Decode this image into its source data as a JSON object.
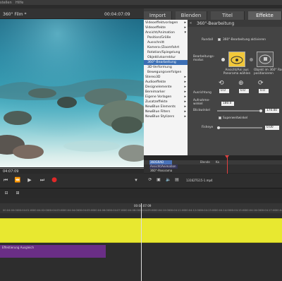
{
  "menubar": {
    "items": [
      "stellen",
      "Hilfe"
    ]
  },
  "preview": {
    "title": "360° Film *",
    "timecode": "00:04:07:09",
    "position_time": "04:07:09"
  },
  "tabs": [
    {
      "label": "Import"
    },
    {
      "label": "Blenden"
    },
    {
      "label": "Titel"
    },
    {
      "label": "Effekte",
      "active": true
    }
  ],
  "effect_list": [
    {
      "label": "Videoeffektvorlagen",
      "arrow": "▸"
    },
    {
      "label": "Videoeffekte",
      "arrow": "▸"
    },
    {
      "label": "Ansicht/Animation",
      "arrow": "▾"
    },
    {
      "label": "Position/Größe",
      "sub": true
    },
    {
      "label": "Ausschnitt",
      "sub": true
    },
    {
      "label": "Kamera-/Zoomfahrt",
      "sub": true
    },
    {
      "label": "Rotation/Spiegelung",
      "sub": true
    },
    {
      "label": "Objektivkorrektur",
      "sub": true
    },
    {
      "label": "360°-Bearbeitung",
      "sub": true,
      "selected": true
    },
    {
      "label": "3D-Verformung",
      "sub": true
    },
    {
      "label": "Bewegungsverfolgen",
      "sub": true
    },
    {
      "label": "Stereo3D",
      "arrow": "▸"
    },
    {
      "label": "Audioeffekte",
      "arrow": "▸"
    },
    {
      "label": "Designelemente",
      "arrow": "▸"
    },
    {
      "label": "Bereimarker",
      "arrow": "▸"
    },
    {
      "label": "Eigene Vorlagen",
      "arrow": "▸"
    },
    {
      "label": "Zusatzeffekte",
      "arrow": "▸"
    },
    {
      "label": "NewBlue Elements",
      "arrow": "▸"
    },
    {
      "label": "NewBlue Filters",
      "arrow": "▸"
    },
    {
      "label": "NewBlue Stylizers",
      "arrow": "▸"
    }
  ],
  "props": {
    "header": "360°-Bearbeitung",
    "rundall": "Rundall",
    "enable_label": "360°-Bearbeitung aktivieren",
    "mode_label": "Bearbeitungs-\nmodus",
    "opt1": "Ansicht/Ani aus\nPanorama wählen",
    "opt2": "Objekt im 360° Raum\npositionieren",
    "ausrichtung": "Ausrichtung",
    "v1": "0.0",
    "v2": "0.0",
    "v3": "0.0",
    "aufnahme": "Aufnahme-\nwinkel",
    "winkel": "180.0",
    "blickwinkel": "Blickwinkel",
    "blick_val": "170.00",
    "superweit": "Superweitwinkel",
    "fisheye": "Fisheye",
    "fish_val": "0.00"
  },
  "strip": {
    "t1": "360GRAD",
    "t2": "Ansicht/Animation",
    "t3": "360°-Panorama",
    "t4": "Blende",
    "t5": "Ka"
  },
  "lower": {
    "file": "13162TG15-1.mp4"
  },
  "ruler": {
    "center": "00:04:07:09",
    "ticks": [
      "00:04:00:00",
      "00:04:01:00",
      "00:04:02:00",
      "00:04:03:00",
      "00:04:04:00",
      "00:04:05:00",
      "00:04:06:00",
      "00:04:07:00",
      "00:04:08:00",
      "00:04:09:00",
      "00:04:10:00",
      "00:04:11:00",
      "00:04:12:00",
      "00:04:13:00",
      "00:04:14:00",
      "00:04:15:00",
      "00:04:16:00",
      "00:04:17:00",
      "00:04:18:00"
    ]
  },
  "tracks": {
    "purple_label": "Effektierung Ausgleich"
  },
  "colors": {
    "selected": "#3c6fb5",
    "yellow_clip": "#e8e830",
    "purple_clip": "#6a2e86",
    "record": "#e02828"
  }
}
